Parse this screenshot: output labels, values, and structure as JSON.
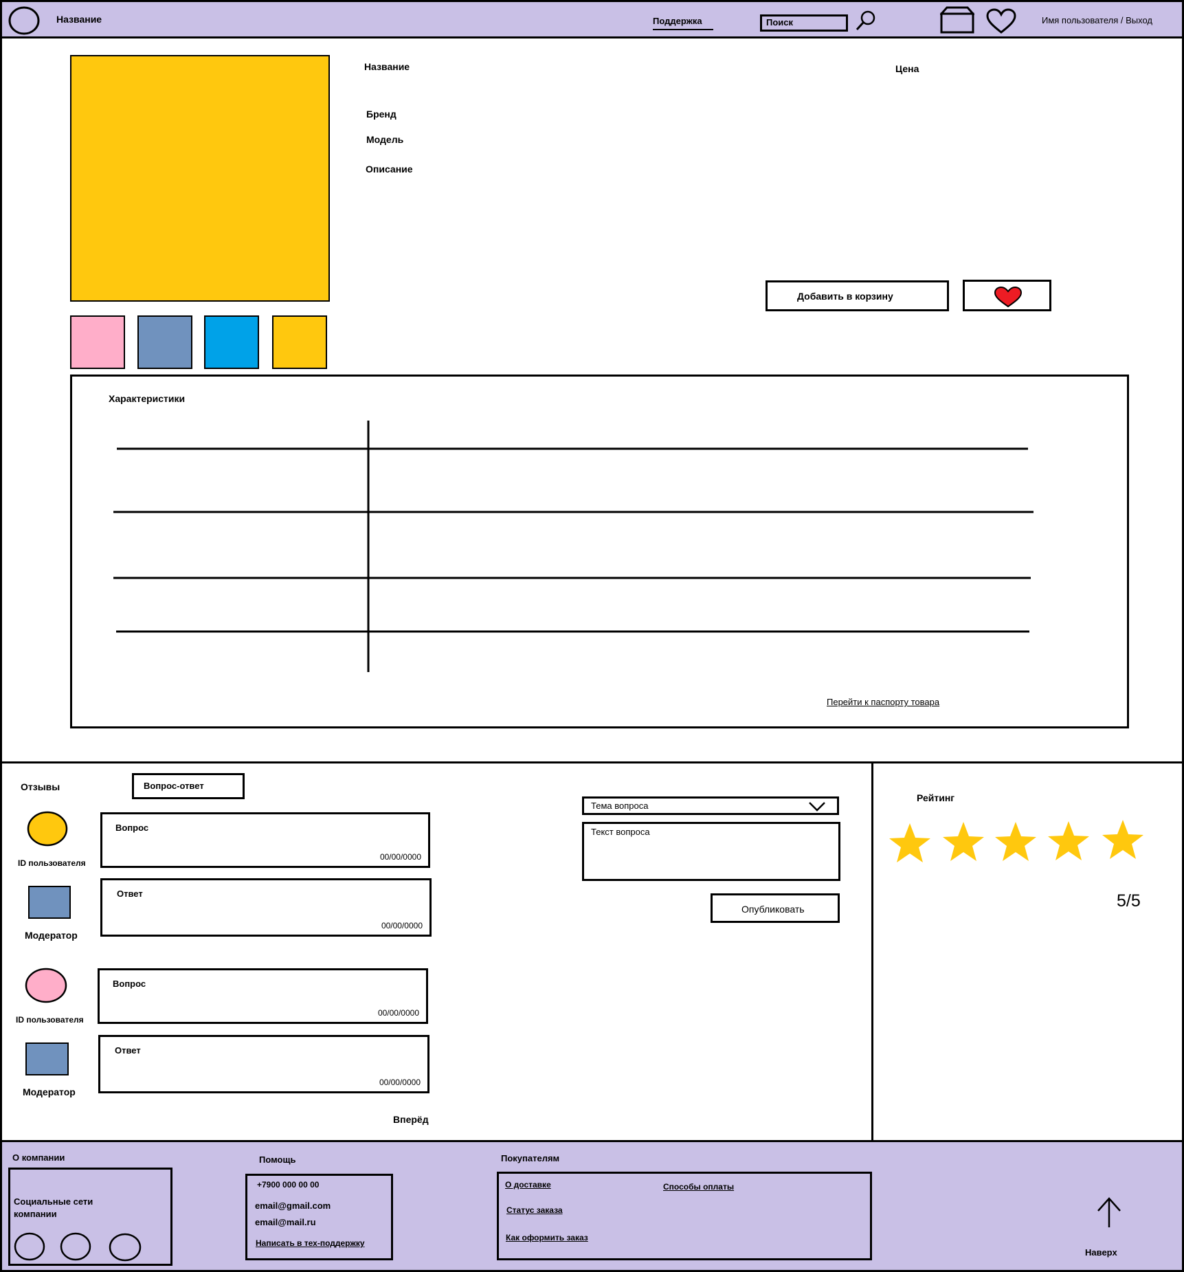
{
  "colors": {
    "header_bg": "#c9c0e6",
    "footer_bg": "#c9c0e6",
    "product_image": "#ffc80e",
    "thumb_pink": "#ffaec9",
    "thumb_slate": "#7092be",
    "thumb_blue": "#00a2e8",
    "thumb_yellow": "#ffc80e",
    "star": "#ffc80e",
    "heart": "#ed1c24"
  },
  "header": {
    "logo_icon": "circle-logo",
    "title": "Название",
    "support": "Поддержка",
    "search_placeholder": "Поиск",
    "search_icon": "magnifier",
    "cart_icon": "box",
    "favorites_icon": "heart-outline",
    "user": "Имя пользователя / Выход"
  },
  "product": {
    "name_label": "Название",
    "price_label": "Цена",
    "brand_label": "Бренд",
    "model_label": "Модель",
    "description_label": "Описание",
    "add_to_cart": "Добавить в корзину",
    "favorite_icon": "heart-filled",
    "thumbnail_count": 4
  },
  "specs": {
    "title": "Характеристики",
    "passport_link": "Перейти к паспорту товара",
    "rows": 4
  },
  "reviews": {
    "tab_reviews": "Отзывы",
    "tab_qa": "Вопрос-ответ",
    "threads": [
      {
        "user_label": "ID пользователя",
        "user_avatar": "yellow-circle",
        "question": "Вопрос",
        "question_date": "00/00/0000",
        "moderator_label": "Модератор",
        "answer": "Ответ",
        "answer_date": "00/00/0000"
      },
      {
        "user_label": "ID пользователя",
        "user_avatar": "pink-circle",
        "question": "Вопрос",
        "question_date": "00/00/0000",
        "moderator_label": "Модератор",
        "answer": "Ответ",
        "answer_date": "00/00/0000"
      }
    ],
    "next": "Вперёд"
  },
  "ask": {
    "topic_placeholder": "Тема вопроса",
    "text_placeholder": "Текст вопроса",
    "publish": "Опубликовать"
  },
  "rating": {
    "title": "Рейтинг",
    "stars": 5,
    "value": "5/5"
  },
  "footer": {
    "about_title": "О компании",
    "socials_label": "Социальные сети компании",
    "socials_count": 3,
    "help_title": "Помощь",
    "phone": "+7900 000 00 00",
    "email1": "email@gmail.com",
    "email2": "email@mail.ru",
    "support_link": "Написать в тех-поддержку",
    "buyers_title": "Покупателям",
    "delivery": "О доставке",
    "payment": "Способы оплаты",
    "order_status": "Статус заказа",
    "how_to_order": "Как оформить заказ",
    "to_top": "Наверх"
  }
}
